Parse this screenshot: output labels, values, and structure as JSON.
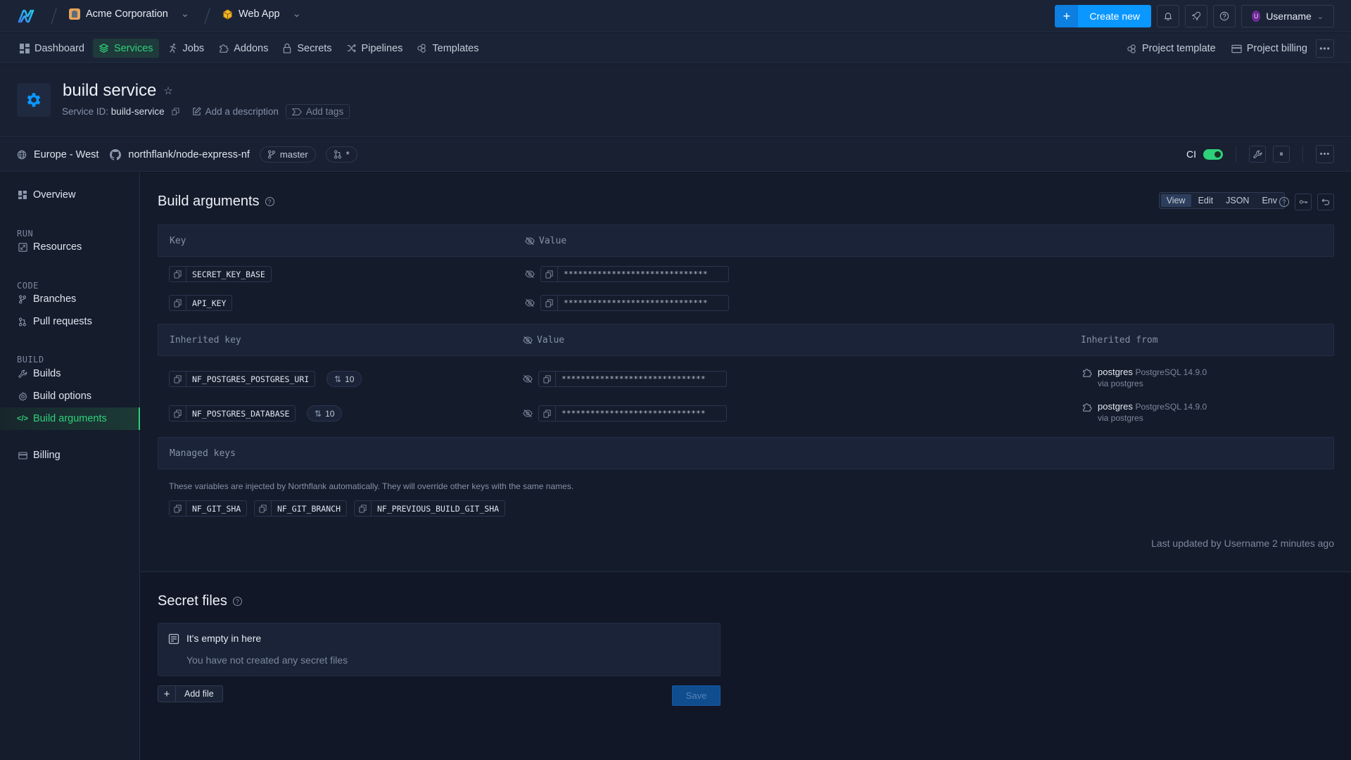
{
  "topbar": {
    "org_name": "Acme Corporation",
    "project_name": "Web App",
    "create_label": "Create new",
    "user_initial": "U",
    "username": "Username"
  },
  "nav": {
    "items": [
      {
        "label": "Dashboard",
        "icon": "dashboard-icon"
      },
      {
        "label": "Services",
        "icon": "layers-icon",
        "active": true
      },
      {
        "label": "Jobs",
        "icon": "running-icon"
      },
      {
        "label": "Addons",
        "icon": "puzzle-icon"
      },
      {
        "label": "Secrets",
        "icon": "lock-icon"
      },
      {
        "label": "Pipelines",
        "icon": "shuffle-icon"
      },
      {
        "label": "Templates",
        "icon": "templates-icon"
      }
    ],
    "project_template": "Project template",
    "project_billing": "Project billing"
  },
  "service": {
    "title": "build service",
    "id_label": "Service ID:",
    "id_value": "build-service",
    "add_description": "Add a description",
    "add_tags": "Add tags",
    "region": "Europe - West",
    "repo": "northflank/node-express-nf",
    "branch": "master",
    "pr": "*",
    "ci_label": "CI",
    "ci_enabled": true
  },
  "sidebar": {
    "overview": "Overview",
    "sections": {
      "run": "RUN",
      "code": "CODE",
      "build": "BUILD"
    },
    "items": {
      "resources": "Resources",
      "branches": "Branches",
      "pull_requests": "Pull requests",
      "builds": "Builds",
      "build_options": "Build options",
      "build_arguments": "Build arguments",
      "billing": "Billing"
    }
  },
  "build_args": {
    "title": "Build arguments",
    "view_modes": [
      "View",
      "Edit",
      "JSON",
      "Env"
    ],
    "active_view": "View",
    "headers": {
      "key": "Key",
      "value": "Value"
    },
    "rows": [
      {
        "key": "SECRET_KEY_BASE",
        "value": "******************************"
      },
      {
        "key": "API_KEY",
        "value": "******************************"
      }
    ],
    "inherited_headers": {
      "key": "Inherited key",
      "value": "Value",
      "from": "Inherited from"
    },
    "inherited_rows": [
      {
        "key": "NF_POSTGRES_POSTGRES_URI",
        "priority": "10",
        "value": "******************************",
        "addon": "postgres",
        "version": "PostgreSQL 14.9.0",
        "via": "via postgres"
      },
      {
        "key": "NF_POSTGRES_DATABASE",
        "priority": "10",
        "value": "******************************",
        "addon": "postgres",
        "version": "PostgreSQL 14.9.0",
        "via": "via postgres"
      }
    ],
    "managed_header": "Managed keys",
    "managed_note": "These variables are injected by Northflank automatically. They will override other keys with the same names.",
    "managed_keys": [
      "NF_GIT_SHA",
      "NF_GIT_BRANCH",
      "NF_PREVIOUS_BUILD_GIT_SHA"
    ],
    "last_updated": "Last updated by Username 2 minutes ago"
  },
  "secret_files": {
    "title": "Secret files",
    "empty_title": "It's empty in here",
    "empty_subtitle": "You have not created any secret files",
    "add_file": "Add file",
    "save": "Save"
  },
  "colors": {
    "accent_green": "#2fd07a",
    "primary_blue": "#0a97ff",
    "background": "#111726"
  }
}
